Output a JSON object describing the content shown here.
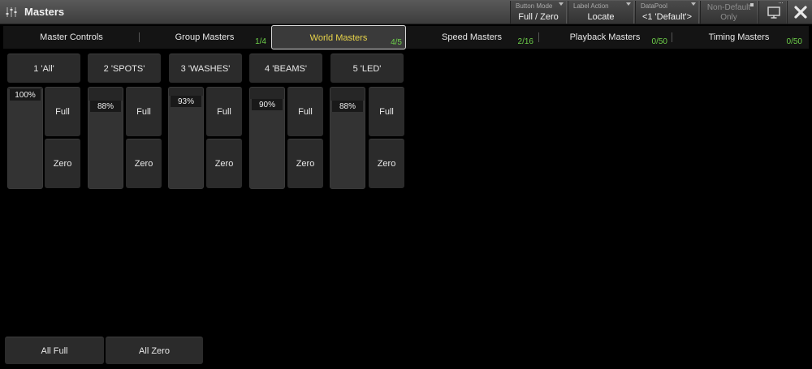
{
  "window": {
    "title": "Masters",
    "title_icon": "faders-icon"
  },
  "toolbar": {
    "button_mode": {
      "label": "Button Mode",
      "value": "Full / Zero"
    },
    "label_action": {
      "label": "Label Action",
      "value": "Locate"
    },
    "datapool": {
      "label": "DataPool",
      "value": "<1 'Default'>"
    },
    "non_default": {
      "line1": "Non-Default",
      "line2": "Only"
    },
    "monitor_icon": "monitor-icon",
    "close_icon": "close-icon"
  },
  "tabs": [
    {
      "label": "Master Controls",
      "count": ""
    },
    {
      "label": "Group Masters",
      "count": "1/4"
    },
    {
      "label": "World Masters",
      "count": "4/5",
      "active": true
    },
    {
      "label": "Speed Masters",
      "count": "2/16"
    },
    {
      "label": "Playback Masters",
      "count": "0/50"
    },
    {
      "label": "Timing Masters",
      "count": "0/50"
    }
  ],
  "masters": [
    {
      "name": "1 'All'",
      "percent_label": "100%",
      "value": 100,
      "full_label": "Full",
      "zero_label": "Zero"
    },
    {
      "name": "2 'SPOTS'",
      "percent_label": "88%",
      "value": 88,
      "full_label": "Full",
      "zero_label": "Zero"
    },
    {
      "name": "3 'WASHES'",
      "percent_label": "93%",
      "value": 93,
      "full_label": "Full",
      "zero_label": "Zero"
    },
    {
      "name": "4 'BEAMS'",
      "percent_label": "90%",
      "value": 90,
      "full_label": "Full",
      "zero_label": "Zero"
    },
    {
      "name": "5 'LED'",
      "percent_label": "88%",
      "value": 88,
      "full_label": "Full",
      "zero_label": "Zero"
    }
  ],
  "footer": {
    "all_full": "All Full",
    "all_zero": "All Zero"
  },
  "colors": {
    "active_tab_text": "#e8d44a",
    "count_text": "#6ed04a"
  }
}
